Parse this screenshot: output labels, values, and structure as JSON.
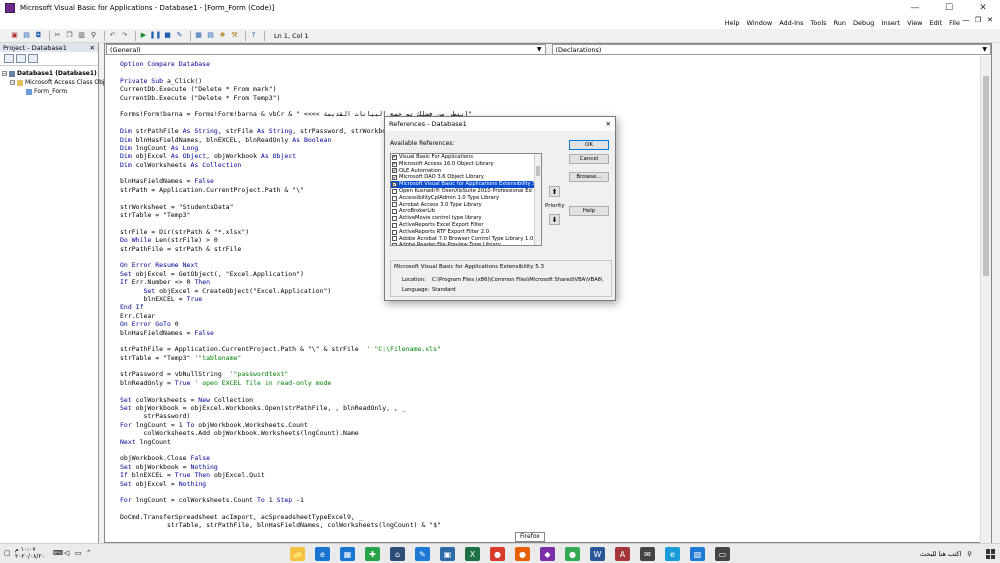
{
  "window": {
    "title": "Microsoft Visual Basic for Applications - Database1 - [Form_Form (Code)]",
    "controls": [
      "—",
      "☐",
      "✕"
    ]
  },
  "menu": {
    "items": [
      "File",
      "Edit",
      "View",
      "Insert",
      "Debug",
      "Run",
      "Tools",
      "Add-Ins",
      "Window",
      "Help"
    ]
  },
  "mdi_controls": [
    "—",
    "❐",
    "✕"
  ],
  "toolbar": {
    "position": "Ln 1, Col 1"
  },
  "project": {
    "title": "Project - Database1",
    "close": "✕",
    "tree": [
      "Database1 (Database1)",
      "Microsoft Access Class Objects",
      "Form_Form"
    ]
  },
  "code_window": {
    "object_combo": "(General)",
    "proc_combo": "(Declarations)",
    "lines": [
      [
        {
          "t": "Option Compare Database",
          "c": "kw"
        }
      ],
      [],
      [
        {
          "t": "Private Sub ",
          "c": "kw"
        },
        {
          "t": "a_Click()"
        }
      ],
      [
        {
          "t": "CurrentDb.Execute (\"Delete * From mark\")"
        }
      ],
      [
        {
          "t": "CurrentDb.Execute (\"Delete * From Temp3\")"
        }
      ],
      [],
      [
        {
          "t": "Forms!Form!barna = Forms!Form!barna & vbCr & \" <<<< انتظر من فضلك تم جمع البيانات القديمة\""
        }
      ],
      [],
      [
        {
          "t": "Dim ",
          "c": "kw"
        },
        {
          "t": "strPathFile "
        },
        {
          "t": "As String",
          "c": "kw"
        },
        {
          "t": ", strFile "
        },
        {
          "t": "As String",
          "c": "kw"
        },
        {
          "t": ", strPassword, strWorkbook"
        }
      ],
      [
        {
          "t": "Dim ",
          "c": "kw"
        },
        {
          "t": "blnHasFieldNames, blnEXCEL, blnReadOnly "
        },
        {
          "t": "As Boolean",
          "c": "kw"
        }
      ],
      [
        {
          "t": "Dim ",
          "c": "kw"
        },
        {
          "t": "lngCount "
        },
        {
          "t": "As Long",
          "c": "kw"
        }
      ],
      [
        {
          "t": "Dim ",
          "c": "kw"
        },
        {
          "t": "objExcel "
        },
        {
          "t": "As Object",
          "c": "kw"
        },
        {
          "t": ", objWorkbook "
        },
        {
          "t": "As Object",
          "c": "kw"
        }
      ],
      [
        {
          "t": "Dim ",
          "c": "kw"
        },
        {
          "t": "colWorksheets "
        },
        {
          "t": "As Collection",
          "c": "kw"
        }
      ],
      [],
      [
        {
          "t": "blnHasFieldNames = "
        },
        {
          "t": "False",
          "c": "kw"
        }
      ],
      [
        {
          "t": "strPath = Application.CurrentProject.Path & \"\\\""
        }
      ],
      [],
      [
        {
          "t": "strWorksheet = \"StudentsData\""
        }
      ],
      [
        {
          "t": "strTable = \"Temp3\""
        }
      ],
      [],
      [
        {
          "t": "strFile = Dir(strPath & \"*.xlsx\")"
        }
      ],
      [
        {
          "t": "Do While ",
          "c": "kw"
        },
        {
          "t": "Len(strFile) > 0"
        }
      ],
      [
        {
          "t": "strPathFile = strPath & strFile"
        }
      ],
      [],
      [
        {
          "t": "On Error Resume Next",
          "c": "kw"
        }
      ],
      [
        {
          "t": "Set ",
          "c": "kw"
        },
        {
          "t": "objExcel = GetObject(, \"Excel.Application\")"
        }
      ],
      [
        {
          "t": "If ",
          "c": "kw"
        },
        {
          "t": "Err.Number <> 0 "
        },
        {
          "t": "Then",
          "c": "kw"
        }
      ],
      [
        {
          "t": "      "
        },
        {
          "t": "Set ",
          "c": "kw"
        },
        {
          "t": "objExcel = CreateObject(\"Excel.Application\")"
        }
      ],
      [
        {
          "t": "      blnEXCEL = "
        },
        {
          "t": "True",
          "c": "kw"
        }
      ],
      [
        {
          "t": "End If",
          "c": "kw"
        }
      ],
      [
        {
          "t": "Err.Clear"
        }
      ],
      [
        {
          "t": "On Error GoTo ",
          "c": "kw"
        },
        {
          "t": "0"
        }
      ],
      [
        {
          "t": "blnHasFieldNames = "
        },
        {
          "t": "False",
          "c": "kw"
        }
      ],
      [],
      [
        {
          "t": "strPathFile = Application.CurrentProject.Path & \"\\\" & strFile  "
        },
        {
          "t": "' \"C:\\Filename.xls\"",
          "c": "cm"
        }
      ],
      [
        {
          "t": "strTable = \"Temp3\" "
        },
        {
          "t": "'\"tablename\"",
          "c": "cm"
        }
      ],
      [],
      [
        {
          "t": "strPassword = vbNullString  "
        },
        {
          "t": "'\"passwordtext\"",
          "c": "cm"
        }
      ],
      [
        {
          "t": "blnReadOnly = "
        },
        {
          "t": "True",
          "c": "kw"
        },
        {
          "t": " "
        },
        {
          "t": "' open EXCEL file in read-only mode",
          "c": "cm"
        }
      ],
      [],
      [
        {
          "t": "Set ",
          "c": "kw"
        },
        {
          "t": "colWorksheets = "
        },
        {
          "t": "New ",
          "c": "kw"
        },
        {
          "t": "Collection"
        }
      ],
      [
        {
          "t": "Set ",
          "c": "kw"
        },
        {
          "t": "objWorkbook = objExcel.Workbooks.Open(strPathFile, , blnReadOnly, , _"
        }
      ],
      [
        {
          "t": "      strPassword)"
        }
      ],
      [
        {
          "t": "For ",
          "c": "kw"
        },
        {
          "t": "lngCount = 1 "
        },
        {
          "t": "To ",
          "c": "kw"
        },
        {
          "t": "objWorkbook.Worksheets.Count"
        }
      ],
      [
        {
          "t": "      colWorksheets.Add objWorkbook.Worksheets(lngCount).Name"
        }
      ],
      [
        {
          "t": "Next ",
          "c": "kw"
        },
        {
          "t": "lngCount"
        }
      ],
      [],
      [
        {
          "t": "objWorkbook.Close "
        },
        {
          "t": "False",
          "c": "kw"
        }
      ],
      [
        {
          "t": "Set ",
          "c": "kw"
        },
        {
          "t": "objWorkbook = "
        },
        {
          "t": "Nothing",
          "c": "kw"
        }
      ],
      [
        {
          "t": "If ",
          "c": "kw"
        },
        {
          "t": "blnEXCEL = "
        },
        {
          "t": "True Then ",
          "c": "kw"
        },
        {
          "t": "objExcel.Quit"
        }
      ],
      [
        {
          "t": "Set ",
          "c": "kw"
        },
        {
          "t": "objExcel = "
        },
        {
          "t": "Nothing",
          "c": "kw"
        }
      ],
      [],
      [
        {
          "t": "For ",
          "c": "kw"
        },
        {
          "t": "lngCount = colWorksheets.Count "
        },
        {
          "t": "To ",
          "c": "kw"
        },
        {
          "t": "1 "
        },
        {
          "t": "Step ",
          "c": "kw"
        },
        {
          "t": "-1"
        }
      ],
      [],
      [
        {
          "t": "DoCmd.TransferSpreadsheet acImport, acSpreadsheetTypeExcel9, _"
        }
      ],
      [
        {
          "t": "            strTable, strPathFile, blnHasFieldNames, colWorksheets(lngCount) & \"$\""
        }
      ]
    ]
  },
  "dialog": {
    "title": "References - Database1",
    "close": "✕",
    "available_label": "Available References:",
    "references": [
      {
        "label": "Visual Basic For Applications",
        "checked": true,
        "selected": false
      },
      {
        "label": "Microsoft Access 16.0 Object Library",
        "checked": true,
        "selected": false
      },
      {
        "label": "OLE Automation",
        "checked": true,
        "selected": false
      },
      {
        "label": "Microsoft DAO 3.6 Object Library",
        "checked": true,
        "selected": false
      },
      {
        "label": "Microsoft Visual Basic for Applications Extensibility 5.3",
        "checked": true,
        "selected": true
      },
      {
        "label": "Open Kusnadi® OsenXlsSuite 2010 Professional Ed",
        "checked": false,
        "selected": false
      },
      {
        "label": "AccessibilityCplAdmin 1.0 Type Library",
        "checked": false,
        "selected": false
      },
      {
        "label": "Acrobat Access 3.0 Type Library",
        "checked": false,
        "selected": false
      },
      {
        "label": "AcroBrokerLib",
        "checked": false,
        "selected": false
      },
      {
        "label": "ActiveMovie control type library",
        "checked": false,
        "selected": false
      },
      {
        "label": "ActiveReports Excel Export Filter",
        "checked": false,
        "selected": false
      },
      {
        "label": "ActiveReports RTF Export Filter 2.0",
        "checked": false,
        "selected": false
      },
      {
        "label": "Adobe Acrobat 7.0 Browser Control Type Library 1.0",
        "checked": false,
        "selected": false
      },
      {
        "label": "Adobe Reader File Preview Type Library",
        "checked": false,
        "selected": false
      }
    ],
    "buttons": {
      "ok": "OK",
      "cancel": "Cancel",
      "browse": "Browse...",
      "help": "Help"
    },
    "priority_label": "Priority",
    "priority_up": "⬆",
    "priority_down": "⬇",
    "info": {
      "title": "Microsoft Visual Basic for Applications Extensibility 5.3",
      "location_label": "Location:",
      "location": "C:\\Program Files (x86)\\Common Files\\Microsoft Shared\\VBA\\VBA6\\",
      "language_label": "Language:",
      "language": "Standard"
    }
  },
  "tooltip": "Firefox",
  "taskbar": {
    "time": "١٠:٠٧ م",
    "date": "٢٠٢٠/٠٨/٢٠",
    "search_placeholder": "اكتب هنا للبحث",
    "apps": [
      {
        "name": "file-explorer-icon",
        "glyph": "📁",
        "color": "#f5c242"
      },
      {
        "name": "edge-icon",
        "glyph": "e",
        "color": "#1a74d2"
      },
      {
        "name": "store-icon",
        "glyph": "▦",
        "color": "#1a74d2"
      },
      {
        "name": "app-green-icon",
        "glyph": "✚",
        "color": "#27a44a"
      },
      {
        "name": "vpn-icon",
        "glyph": "⌂",
        "color": "#2d4d79"
      },
      {
        "name": "pen-icon",
        "glyph": "✎",
        "color": "#1f7ad6"
      },
      {
        "name": "photos-icon",
        "glyph": "▣",
        "color": "#2c6aa8"
      },
      {
        "name": "excel-icon",
        "glyph": "X",
        "color": "#1d7044"
      },
      {
        "name": "chrome-icon",
        "glyph": "●",
        "color": "#d93b2b"
      },
      {
        "name": "firefox-icon",
        "glyph": "●",
        "color": "#e66000"
      },
      {
        "name": "app-purple-icon",
        "glyph": "◆",
        "color": "#7a2fa8"
      },
      {
        "name": "chrome2-icon",
        "glyph": "●",
        "color": "#34a853"
      },
      {
        "name": "word-icon",
        "glyph": "W",
        "color": "#2b579a"
      },
      {
        "name": "access-icon",
        "glyph": "A",
        "color": "#a4373a"
      },
      {
        "name": "mail-icon",
        "glyph": "✉",
        "color": "#444444"
      },
      {
        "name": "ie-icon",
        "glyph": "e",
        "color": "#1a9bd7"
      },
      {
        "name": "photo-viewer-icon",
        "glyph": "▧",
        "color": "#1f7ad6"
      },
      {
        "name": "task-view-icon",
        "glyph": "▭",
        "color": "#444444"
      }
    ]
  }
}
